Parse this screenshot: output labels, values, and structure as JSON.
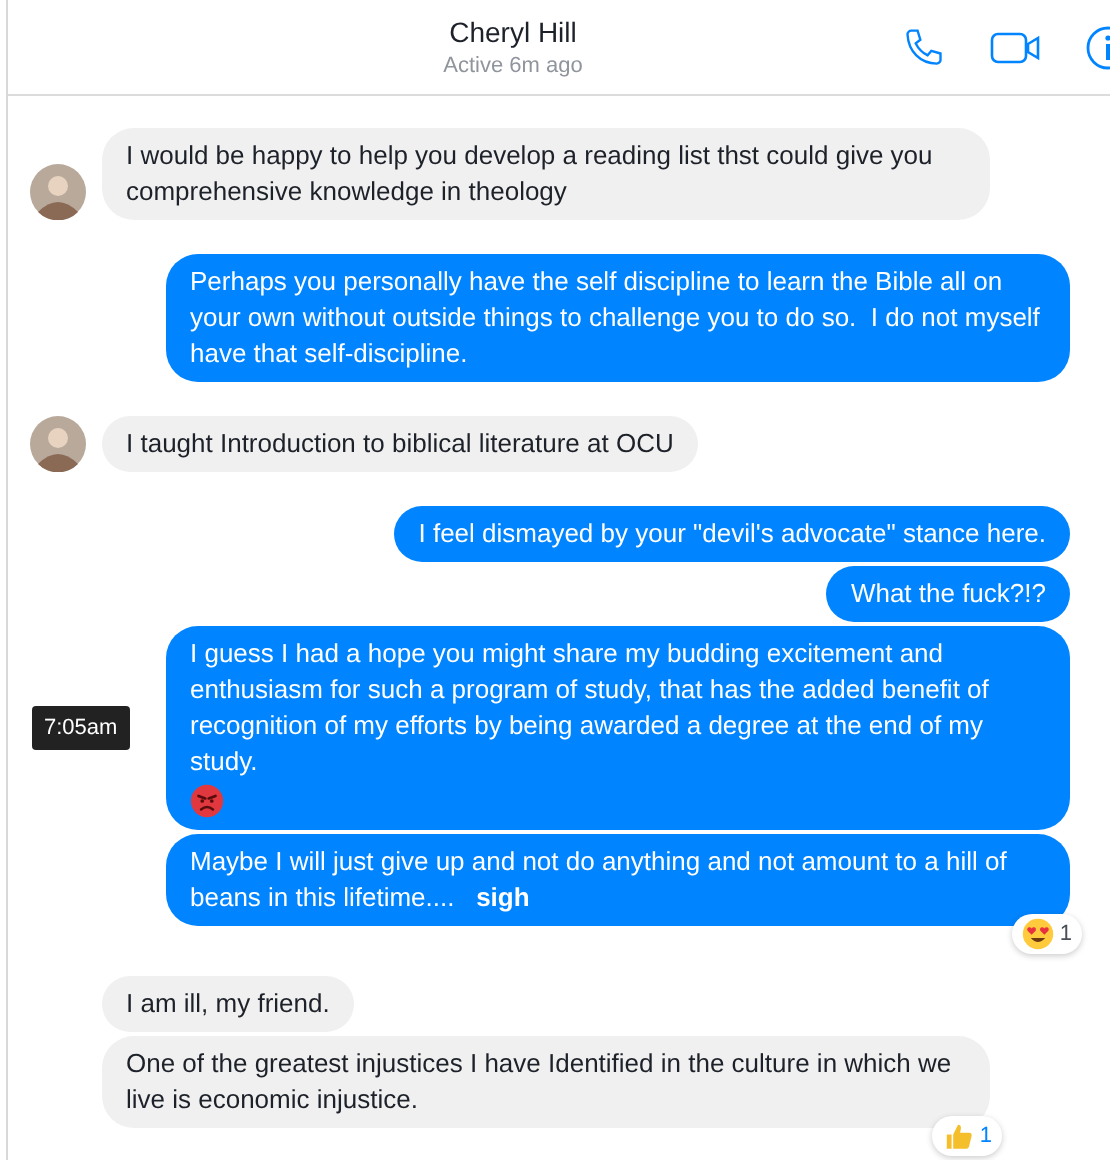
{
  "header": {
    "name": "Cheryl Hill",
    "status": "Active 6m ago"
  },
  "groups": [
    {
      "kind": "them",
      "avatar": true,
      "messages": [
        {
          "text": "I would be happy to help you develop a reading list thst could give you comprehensive knowledge in theology"
        }
      ]
    },
    {
      "kind": "me",
      "avatar": false,
      "messages": [
        {
          "text": "Perhaps you personally have the self discipline to learn the Bible all on your own without outside things to challenge you to do so.  I do not myself have that self-discipline."
        }
      ]
    },
    {
      "kind": "them",
      "avatar": true,
      "messages": [
        {
          "text": "I taught Introduction to biblical literature at OCU"
        }
      ]
    },
    {
      "kind": "me",
      "avatar": false,
      "messages": [
        {
          "text": "I feel dismayed by your \"devil's advocate\" stance here."
        },
        {
          "text": "What the fuck?!?"
        },
        {
          "kind": "angry-emoji",
          "text": "I guess I had a hope you might share my budding excitement and enthusiasm for such a program of study, that has the added benefit of recognition of my efforts by being awarded a degree at the end of my study.",
          "time": "7:05am"
        },
        {
          "text": "Maybe I will just give up and not do anything and not amount to a hill of beans in this lifetime....   **sigh**",
          "reaction": {
            "kind": "heart-eyes",
            "count": "1",
            "selected": false
          }
        }
      ]
    },
    {
      "kind": "them",
      "avatar": false,
      "messages": [
        {
          "text": "I am ill, my friend."
        },
        {
          "text": "One of the greatest injustices I have Identified in the culture in which we live is economic injustice.",
          "reaction": {
            "kind": "thumbs-up",
            "count": "1",
            "selected": true
          }
        }
      ]
    }
  ]
}
